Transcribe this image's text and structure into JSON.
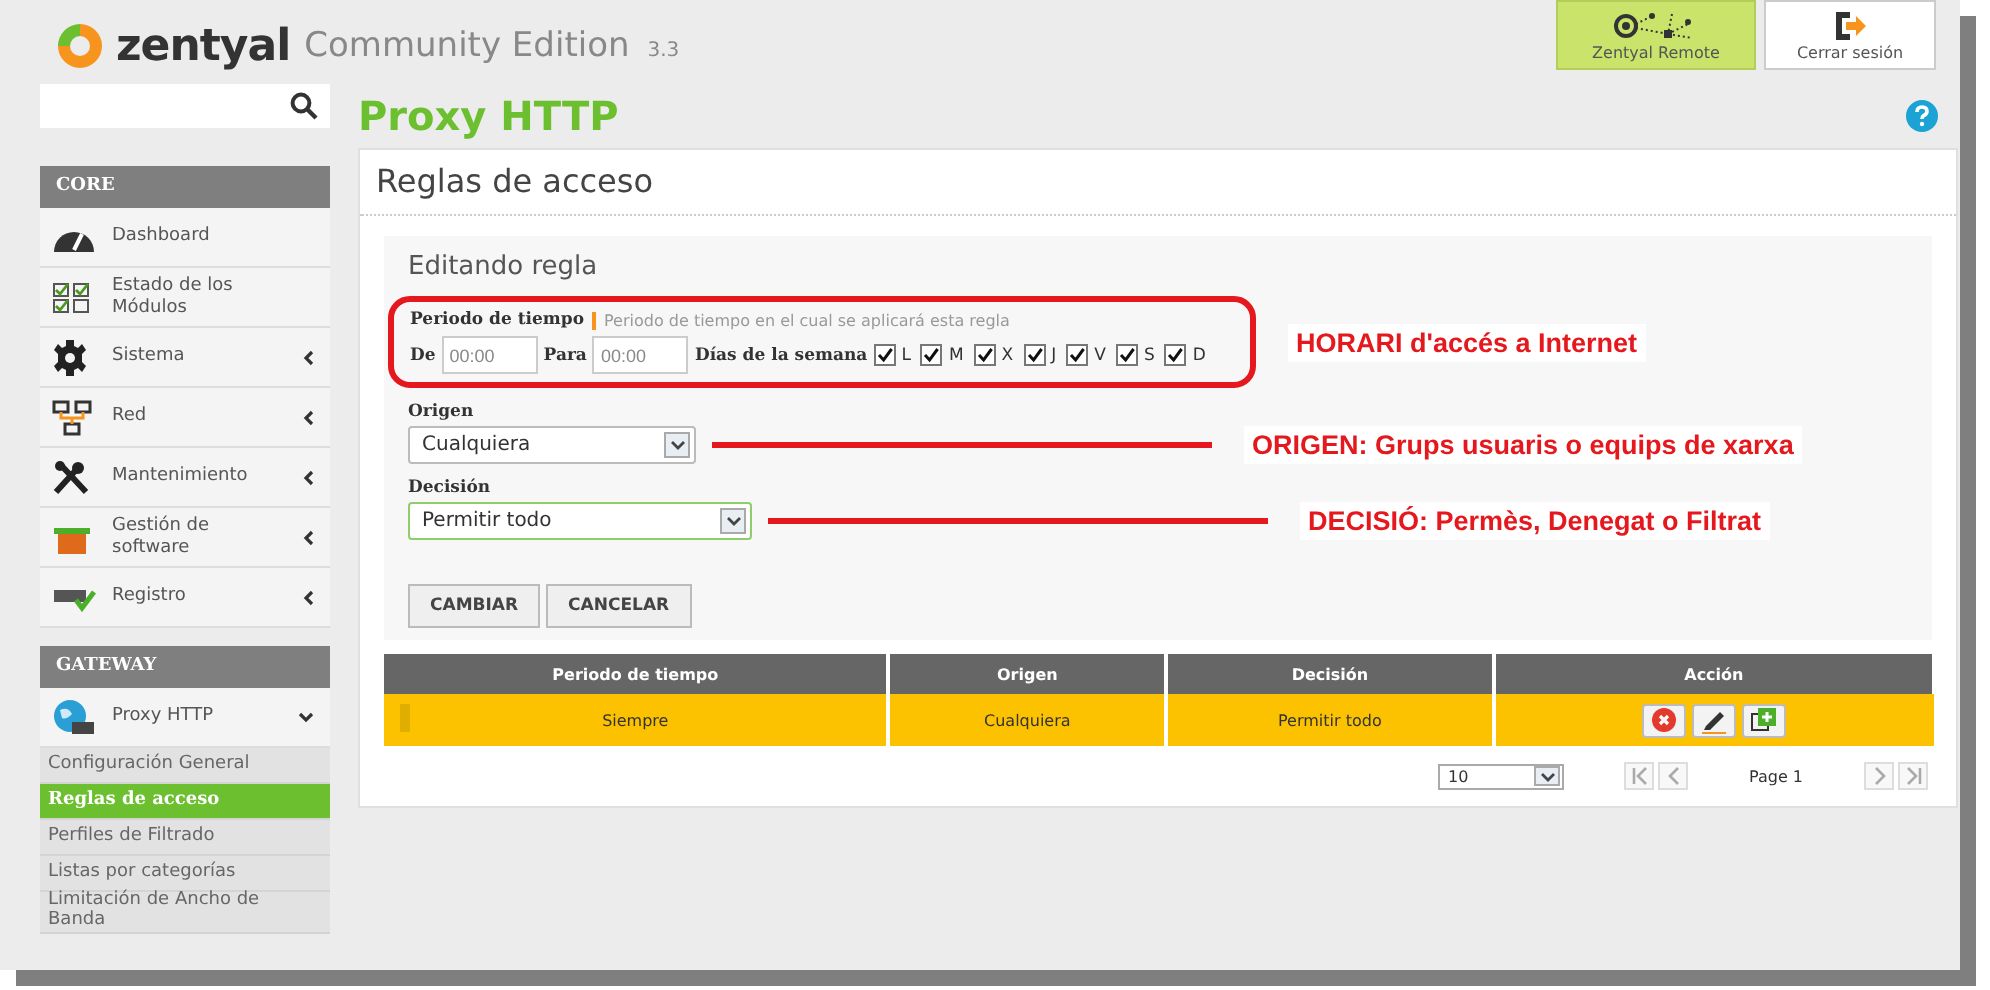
{
  "header": {
    "logo_text": "zentyal",
    "edition": "Community Edition",
    "version": "3.3",
    "buttons": [
      {
        "label": "Zentyal Remote",
        "kind": "remote"
      },
      {
        "label": "Cerrar sesión",
        "kind": "logout"
      }
    ]
  },
  "sidebar": {
    "sections": [
      {
        "title": "CORE",
        "items": [
          {
            "label": "Dashboard",
            "kind": "dashboard"
          },
          {
            "label": "Estado de los Módulos",
            "kind": "modules"
          },
          {
            "label": "Sistema",
            "kind": "system",
            "expanded": false
          },
          {
            "label": "Red",
            "kind": "network",
            "expanded": false
          },
          {
            "label": "Mantenimiento",
            "kind": "maintenance",
            "expanded": false
          },
          {
            "label": "Gestión de software",
            "kind": "software",
            "expanded": false
          },
          {
            "label": "Registro",
            "kind": "logs",
            "expanded": false
          }
        ]
      },
      {
        "title": "GATEWAY",
        "items": [
          {
            "label": "Proxy HTTP",
            "kind": "proxy",
            "expanded": true,
            "children": [
              {
                "label": "Configuración General",
                "selected": false
              },
              {
                "label": "Reglas de acceso",
                "selected": true
              },
              {
                "label": "Perfiles de Filtrado",
                "selected": false
              },
              {
                "label": "Listas por categorías",
                "selected": false
              },
              {
                "label": "Limitación de Ancho de Banda",
                "selected": false
              }
            ]
          }
        ]
      }
    ]
  },
  "page": {
    "title": "Proxy HTTP",
    "panel_title": "Reglas de acceso",
    "form": {
      "title": "Editando regla",
      "period": {
        "label": "Periodo de tiempo",
        "hint": "Periodo de tiempo en el cual se aplicará esta regla",
        "from_label": "De",
        "from_placeholder": "00:00",
        "to_label": "Para",
        "to_placeholder": "00:00",
        "days_label": "Días de la semana",
        "days": [
          {
            "label": "L",
            "checked": true
          },
          {
            "label": "M",
            "checked": true
          },
          {
            "label": "X",
            "checked": true
          },
          {
            "label": "J",
            "checked": true
          },
          {
            "label": "V",
            "checked": true
          },
          {
            "label": "S",
            "checked": true
          },
          {
            "label": "D",
            "checked": true
          }
        ],
        "annotation": "HORARI d'accés a Internet"
      },
      "selects": [
        {
          "label": "Origen",
          "value": "Cualquiera",
          "focused": false,
          "annotation": "ORIGEN: Grups usuaris o equips de xarxa"
        },
        {
          "label": "Decisión",
          "value": "Permitir todo",
          "focused": true,
          "annotation": "DECISIÓ:  Permès, Denegat o Filtrat"
        }
      ],
      "buttons": [
        "CAMBIAR",
        "CANCELAR"
      ]
    },
    "table": {
      "columns": [
        "Periodo de tiempo",
        "Origen",
        "Decisión",
        "Acción"
      ],
      "rows": [
        {
          "cells": [
            "Siempre",
            "Cualquiera",
            "Permitir todo"
          ],
          "selected": true
        }
      ]
    },
    "pagination": {
      "page_size": "10",
      "page_label": "Page 1"
    }
  }
}
